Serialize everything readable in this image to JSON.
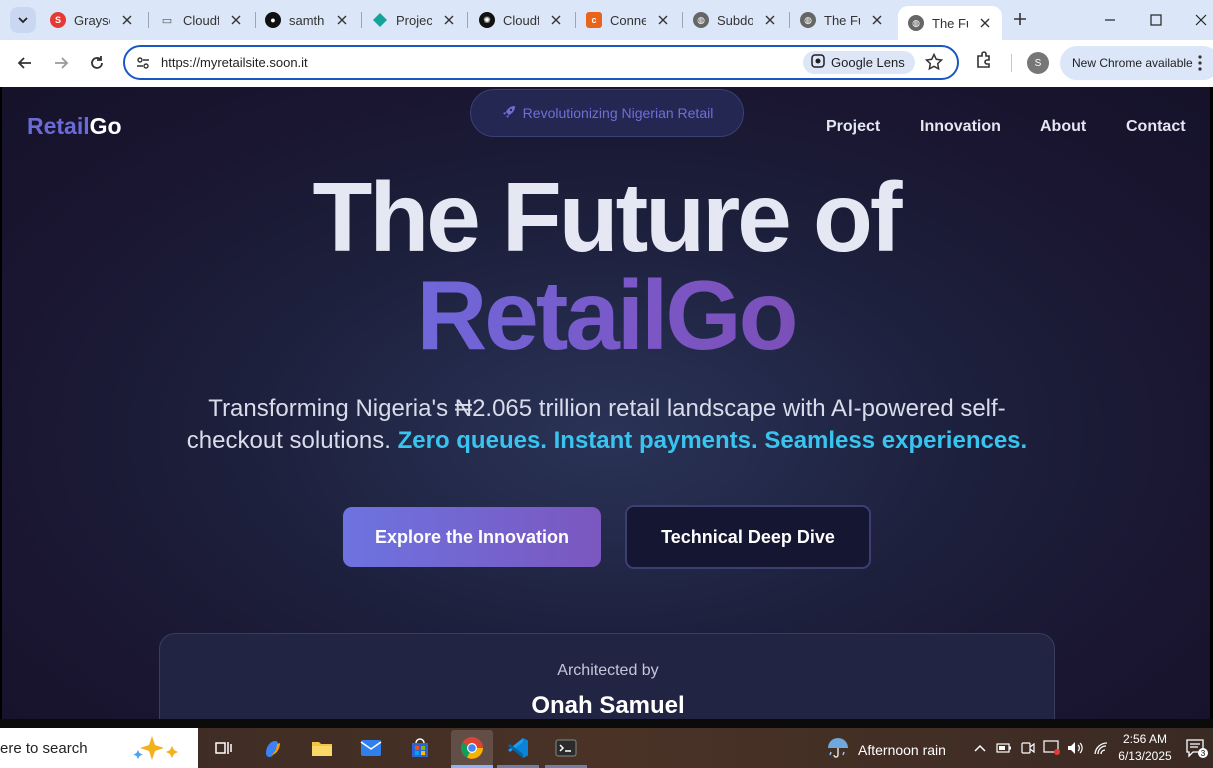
{
  "browser": {
    "tabs": [
      {
        "title": "Grayscale",
        "icon": "grayscale-icon",
        "color": "#e53935"
      },
      {
        "title": "Cloudflare",
        "icon": "cloud-dash-icon",
        "color": "#555555"
      },
      {
        "title": "samthedev",
        "icon": "github-icon",
        "color": "#111111"
      },
      {
        "title": "Project",
        "icon": "diamond-icon",
        "color": "#14a39a"
      },
      {
        "title": "Cloudflare",
        "icon": "openai-icon",
        "color": "#111111"
      },
      {
        "title": "Connect",
        "icon": "cpanel-icon",
        "color": "#e8641b"
      },
      {
        "title": "Subdomain",
        "icon": "globe-icon",
        "color": "#555555"
      },
      {
        "title": "The Future",
        "icon": "globe-icon",
        "color": "#555555"
      },
      {
        "title": "The Future",
        "icon": "globe-icon",
        "color": "#555555",
        "active": true
      }
    ],
    "url": "https://myretailsite.soon.it",
    "lens_label": "Google Lens",
    "profile_initial": "S",
    "update_label": "New Chrome available"
  },
  "site": {
    "badge": "Revolutionizing Nigerian Retail",
    "logo_a": "Retail",
    "logo_b": "Go",
    "nav": [
      "Project",
      "Innovation",
      "About",
      "Contact"
    ],
    "hero_line1": "The Future of",
    "hero_line2": "RetailGo",
    "subtitle_plain": "Transforming Nigeria's ₦2.065 trillion retail landscape with AI-powered self-checkout solutions. ",
    "subtitle_highlight": "Zero queues. Instant payments. Seamless experiences.",
    "cta_primary": "Explore the Innovation",
    "cta_secondary": "Technical Deep Dive",
    "card_label": "Architected by",
    "card_name": "Onah Samuel"
  },
  "taskbar": {
    "search_text": "ere to search",
    "weather": "Afternoon rain",
    "time": "2:56 AM",
    "date": "6/13/2025",
    "notifications": "3"
  }
}
